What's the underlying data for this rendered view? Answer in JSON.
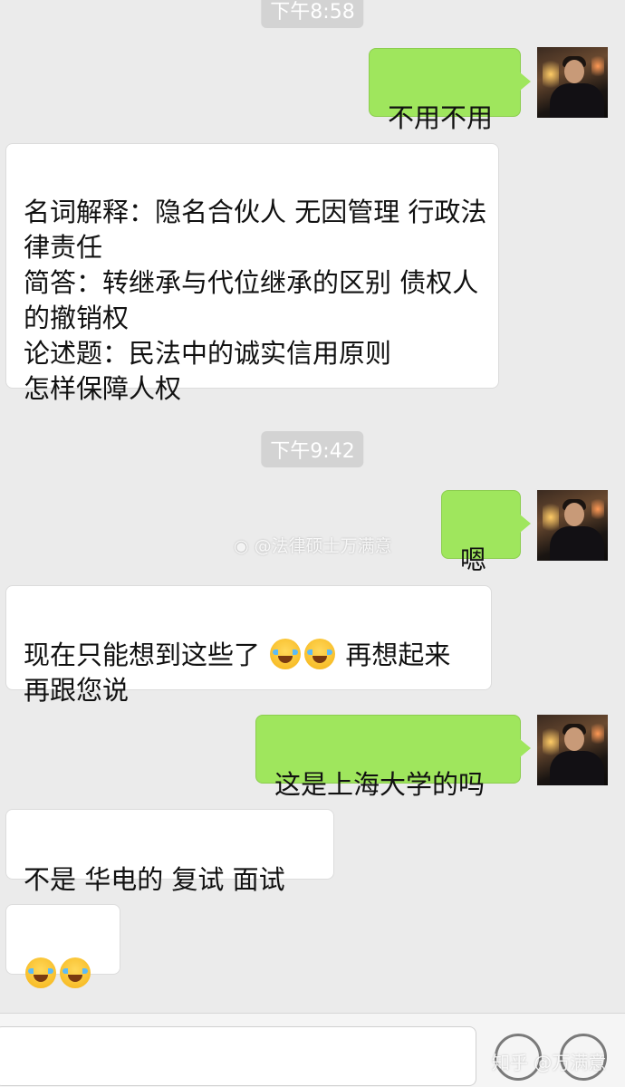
{
  "timestamps": [
    "下午8:58",
    "下午9:42"
  ],
  "messages": {
    "m1": "不用不用",
    "m2": "名词解释：隐名合伙人  无因管理  行政法律责任\n简答：转继承与代位继承的区别    债权人的撤销权\n论述题：民法中的诚实信用原则\n怎样保障人权",
    "m3": "嗯",
    "m4a": " 现在只能想到这些了  ",
    "m4b": "  再想起来  再跟您说",
    "m5": "这是上海大学的吗",
    "m6": "不是  华电的 复试  面试"
  },
  "watermarks": {
    "weibo": "@法律硕士万满意",
    "zhihu": "知乎 @万满意"
  },
  "emoji": "loudly-laughing-crying-face",
  "colors": {
    "background": "#ebebeb",
    "sent_bubble": "#9fe65d",
    "received_bubble": "#ffffff",
    "timestamp_pill": "#d3d3d3"
  }
}
